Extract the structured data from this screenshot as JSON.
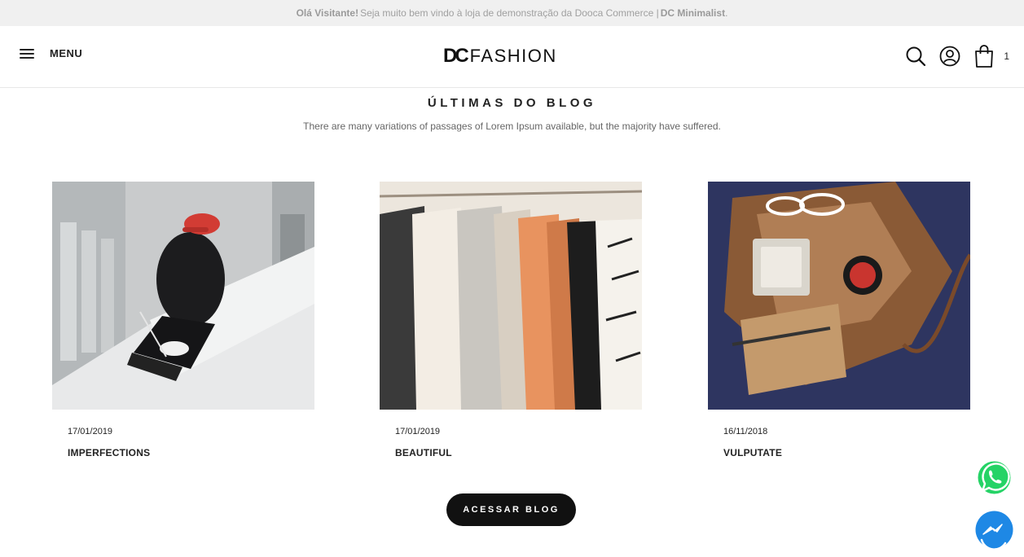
{
  "topbar": {
    "greeting": "Olá Visitante!",
    "welcome": "Seja muito bem vindo à loja de demonstração da Dooca Commerce |",
    "theme": "DC Minimalist",
    "period": "."
  },
  "header": {
    "menu_label": "MENU",
    "logo_mark": "DC",
    "logo_text": "FASHION",
    "cart_count": "1"
  },
  "section": {
    "title": "ÚLTIMAS DO BLOG",
    "subtitle": "There are many variations of passages of Lorem Ipsum available, but the majority have suffered."
  },
  "posts": [
    {
      "date": "17/01/2019",
      "title": "IMPERFECTIONS"
    },
    {
      "date": "17/01/2019",
      "title": "BEAUTIFUL"
    },
    {
      "date": "16/11/2018",
      "title": "VULPUTATE"
    }
  ],
  "cta": {
    "label": "ACESSAR BLOG"
  },
  "colors": {
    "accent": "#111111",
    "whatsapp": "#25d366",
    "messenger": "#1e88e5"
  }
}
